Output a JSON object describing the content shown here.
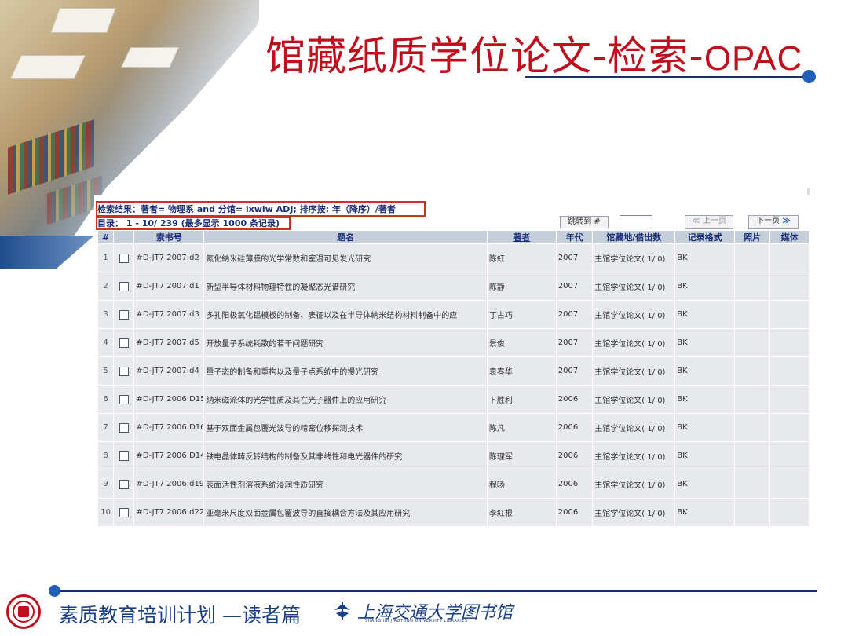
{
  "slide": {
    "title_cn": "馆藏纸质学位论文-检索-",
    "title_en": "OPAC",
    "footer_text": "素质教育培训计划 —读者篇",
    "library_name": "上海交通大学图书馆",
    "library_name_en": "SHANGHAI JIAOTONG UNIVERSITY LIBRARIES"
  },
  "opac": {
    "search_result_line": "检索结果：著者= 物理系 and 分馆= lxwlw ADJ; 排序按: 年（降序）/著者",
    "directory_line": "目录：   1 - 10/ 239 (最多显示  1000 条记录)",
    "jump_button": "跳转到 #",
    "jump_value": "",
    "prev_button": "上一页",
    "next_button": "下一页",
    "columns": [
      "#",
      "",
      "索书号",
      "题名",
      "著者",
      "年代",
      "馆藏地/借出数",
      "记录格式",
      "照片",
      "媒体"
    ],
    "rows": [
      {
        "no": "1",
        "call": "#D-JT7 2007:d2",
        "title": "氮化納米硅薄膜的光学常数和室温可见发光研究",
        "author": "陈紅",
        "year": "2007",
        "holding": "主馆学位论文( 1/ 0)",
        "format": "BK"
      },
      {
        "no": "2",
        "call": "#D-JT7 2007:d1",
        "title": "新型半导体材料物理特性的凝聚态光谱研究",
        "author": "陈静",
        "year": "2007",
        "holding": "主馆学位论文( 1/ 0)",
        "format": "BK"
      },
      {
        "no": "3",
        "call": "#D-JT7 2007:d3",
        "title": "多孔阳极氧化铝模板的制备、表征以及在半导体納米结构材料制备中的应",
        "author": "丁古巧",
        "year": "2007",
        "holding": "主馆学位论文( 1/ 0)",
        "format": "BK"
      },
      {
        "no": "4",
        "call": "#D-JT7 2007:d5",
        "title": "开放量子系统耗散的若干问题研究",
        "author": "景俊",
        "year": "2007",
        "holding": "主馆学位论文( 1/ 0)",
        "format": "BK"
      },
      {
        "no": "5",
        "call": "#D-JT7 2007:d4",
        "title": "量子态的制备和重构以及量子点系统中的慢光研究",
        "author": "袁春华",
        "year": "2007",
        "holding": "主馆学位论文( 1/ 0)",
        "format": "BK"
      },
      {
        "no": "6",
        "call": "#D-JT7 2006:D15",
        "title": "納米磁流体的光学性质及其在光子器件上的应用研究",
        "author": "卜胜利",
        "year": "2006",
        "holding": "主馆学位论文( 1/ 0)",
        "format": "BK"
      },
      {
        "no": "7",
        "call": "#D-JT7 2006:D16",
        "title": "基于双面金属包覆光波导的精密位移探测技术",
        "author": "陈凡",
        "year": "2006",
        "holding": "主馆学位论文( 1/ 0)",
        "format": "BK"
      },
      {
        "no": "8",
        "call": "#D-JT7 2006:D14",
        "title": "铁电晶体畴反转结构的制备及其非线性和电光器件的研究",
        "author": "陈理军",
        "year": "2006",
        "holding": "主馆学位论文( 1/ 0)",
        "format": "BK"
      },
      {
        "no": "9",
        "call": "#D-JT7 2006:d19",
        "title": "表面活性剂溶液系统浸润性质研究",
        "author": "程旸",
        "year": "2006",
        "holding": "主馆学位论文( 1/ 0)",
        "format": "BK"
      },
      {
        "no": "10",
        "call": "#D-JT7 2006:d22",
        "title": "亚毫米尺度双面金属包覆波导的直接耦合方法及其应用研究",
        "author": "李紅根",
        "year": "2006",
        "holding": "主馆学位论文( 1/ 0)",
        "format": "BK"
      }
    ]
  },
  "colors": {
    "title_red": "#c0101e",
    "navy": "#1b2f6b",
    "accent_blue": "#1f5fb8",
    "highlight_red": "#c8341c",
    "header_bg": "#c5ced9",
    "row_bg": "#e7e9ec"
  },
  "icons": [
    "library-photo",
    "title-dot-icon",
    "footer-dot-icon",
    "university-seal-icon",
    "library-logo-icon",
    "prev-arrow-icon",
    "next-arrow-icon",
    "checkbox-icon"
  ]
}
